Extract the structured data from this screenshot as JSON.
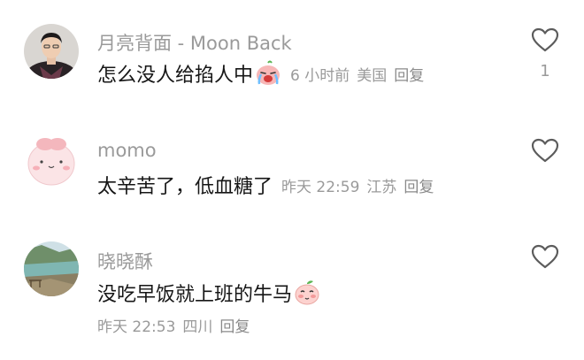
{
  "comments": [
    {
      "username": "月亮背面 - Moon Back",
      "text": "怎么没人给掐人中",
      "emoji": "crying-face-emoji",
      "time": "6 小时前",
      "location": "美国",
      "reply_label": "回复",
      "like_count": "1"
    },
    {
      "username": "momo",
      "text": "太辛苦了，低血糖了",
      "time": "昨天 22:59",
      "location": "江苏",
      "reply_label": "回复",
      "like_count": ""
    },
    {
      "username": "晓晓酥",
      "text": "没吃早饭就上班的牛马",
      "emoji": "peach-blush-emoji",
      "time": "昨天 22:53",
      "location": "四川",
      "reply_label": "回复",
      "like_count": ""
    }
  ],
  "icons": {
    "like": "heart-outline-icon"
  },
  "colors": {
    "username": "#9a9a9a",
    "body_text": "#161616",
    "meta": "#9a9a9a"
  }
}
